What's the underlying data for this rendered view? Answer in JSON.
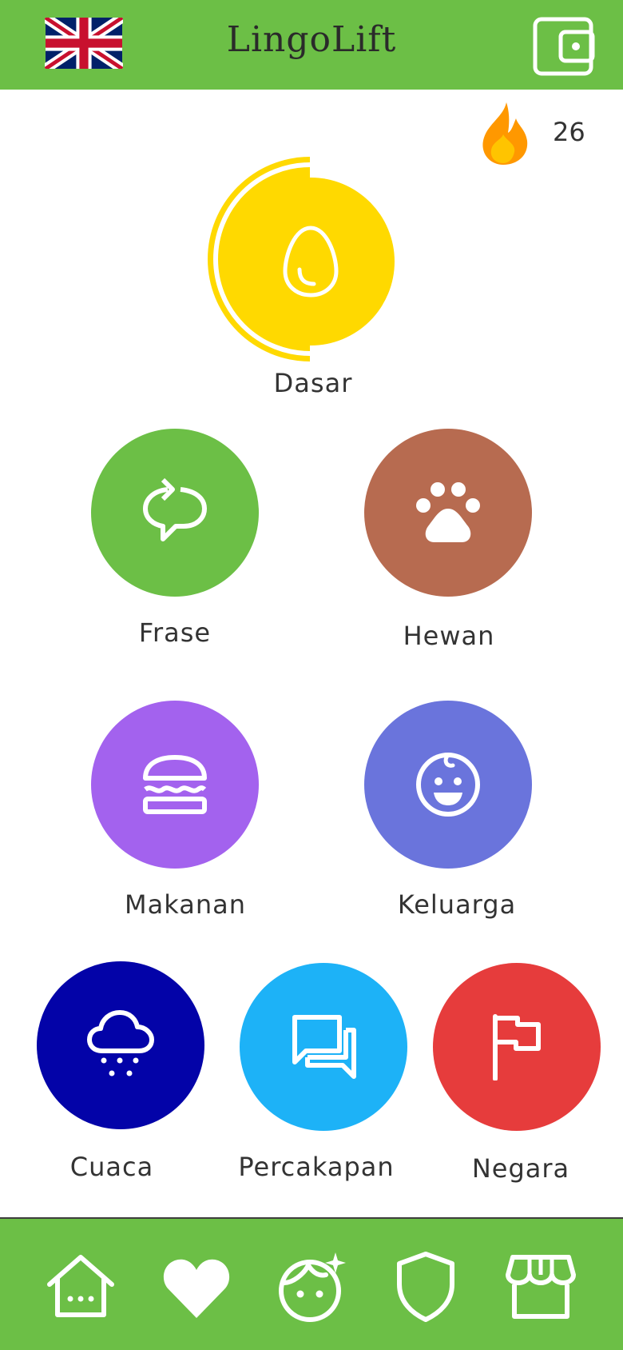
{
  "header": {
    "title": "LingoLift",
    "flag_icon": "uk-flag-icon",
    "wallet_icon": "wallet-icon"
  },
  "streak": {
    "icon": "flame-icon",
    "count": "26"
  },
  "lessons": [
    {
      "label": "Dasar",
      "icon": "egg-icon",
      "color": "#ffd900",
      "progress": 0.5
    },
    {
      "label": "Frase",
      "icon": "repeat-chat-icon",
      "color": "#6cbf46"
    },
    {
      "label": "Hewan",
      "icon": "paw-icon",
      "color": "#b76b50"
    },
    {
      "label": "Makanan",
      "icon": "burger-icon",
      "color": "#a362ee"
    },
    {
      "label": "Keluarga",
      "icon": "baby-face-icon",
      "color": "#6a74dc"
    },
    {
      "label": "Cuaca",
      "icon": "snow-cloud-icon",
      "color": "#0303a8"
    },
    {
      "label": "Percakapan",
      "icon": "chat-bubbles-icon",
      "color": "#1db2f7"
    },
    {
      "label": "Negara",
      "icon": "flag-icon",
      "color": "#e63c3c"
    }
  ],
  "bottom_nav": [
    {
      "icon": "home-icon"
    },
    {
      "icon": "heart-icon"
    },
    {
      "icon": "profile-face-icon"
    },
    {
      "icon": "shield-icon"
    },
    {
      "icon": "store-icon"
    }
  ],
  "colors": {
    "brand_green": "#6cbf46",
    "streak_orange": "#ff9800"
  }
}
